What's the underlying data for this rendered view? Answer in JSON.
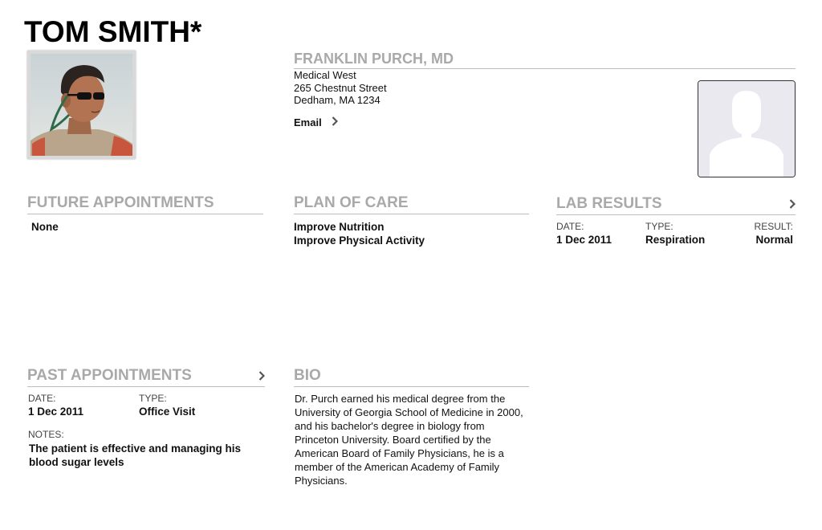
{
  "patient": {
    "name": "TOM SMITH*",
    "photo_icon": "patient-photo"
  },
  "doctor": {
    "name": "FRANKLIN PURCH, MD",
    "address_lines": [
      "Medical West",
      "265 Chestnut Street",
      "Dedham, MA 1234"
    ],
    "email_label": "Email",
    "photo_icon": "person-placeholder-icon"
  },
  "future_appointments": {
    "title": "FUTURE APPOINTMENTS",
    "value": "None"
  },
  "plan_of_care": {
    "title": "PLAN OF CARE",
    "items": [
      "Improve Nutrition",
      "Improve Physical Activity"
    ]
  },
  "lab_results": {
    "title": "LAB RESULTS",
    "date_label": "DATE:",
    "type_label": "TYPE:",
    "result_label": "RESULT:",
    "date": "1 Dec 2011",
    "type": "Respiration",
    "result": "Normal"
  },
  "past_appointments": {
    "title": "PAST APPOINTMENTS",
    "date_label": "DATE:",
    "type_label": "TYPE:",
    "date": "1 Dec 2011",
    "type": "Office Visit",
    "notes_label": "NOTES:",
    "notes": "The patient is effective and managing his blood sugar levels"
  },
  "bio": {
    "title": "BIO",
    "text": "Dr. Purch earned his medical degree from the University of Georgia School of Medicine in 2000, and his bachelor's degree in biology from Princeton University. Board certified by the American Board of Family Physicians, he is a member of the American Academy of Family Physicians."
  },
  "colors": {
    "section_title": "#a9a9a9",
    "divider": "#bdbdbd",
    "text": "#111111"
  }
}
